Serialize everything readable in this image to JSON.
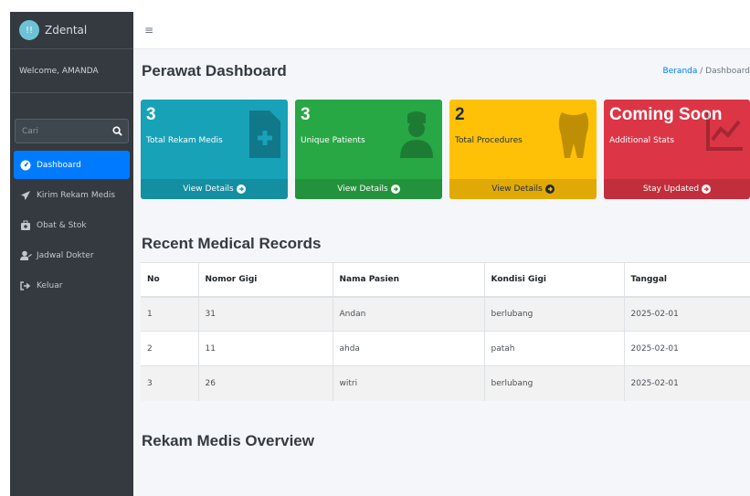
{
  "brand": {
    "name": "Zdental",
    "logo_glyph": "!!"
  },
  "sidebar": {
    "welcome": "Welcome, AMANDA",
    "search_placeholder": "Cari",
    "items": [
      {
        "label": "Dashboard",
        "icon": "tachometer-icon",
        "active": true
      },
      {
        "label": "Kirim Rekam Medis",
        "icon": "paper-plane-icon",
        "active": false
      },
      {
        "label": "Obat & Stok",
        "icon": "medkit-icon",
        "active": false
      },
      {
        "label": "Jadwal Dokter",
        "icon": "user-clock-icon",
        "active": false
      },
      {
        "label": "Keluar",
        "icon": "sign-out-icon",
        "active": false
      }
    ]
  },
  "header": {
    "title": "Perawat Dashboard",
    "breadcrumb_home": "Beranda",
    "breadcrumb_sep": "/",
    "breadcrumb_current": "Dashboard"
  },
  "boxes": [
    {
      "count": "3",
      "label": "Total Rekam Medis",
      "footer": "View Details",
      "color": "#17a2b8",
      "icon": "file-medical-icon"
    },
    {
      "count": "3",
      "label": "Unique Patients",
      "footer": "View Details",
      "color": "#28a745",
      "icon": "user-nurse-icon"
    },
    {
      "count": "2",
      "label": "Total Procedures",
      "footer": "View Details",
      "color": "#ffc107",
      "icon": "tooth-icon"
    },
    {
      "count": "Coming Soon",
      "label": "Additional Stats",
      "footer": "Stay Updated",
      "color": "#dc3545",
      "icon": "chart-line-icon"
    }
  ],
  "records": {
    "title": "Recent Medical Records",
    "columns": [
      "No",
      "Nomor Gigi",
      "Nama Pasien",
      "Kondisi Gigi",
      "Tanggal"
    ],
    "rows": [
      [
        "1",
        "31",
        "Andan",
        "berlubang",
        "2025-02-01"
      ],
      [
        "2",
        "11",
        "ahda",
        "patah",
        "2025-02-01"
      ],
      [
        "3",
        "26",
        "witri",
        "berlubang",
        "2025-02-01"
      ]
    ]
  },
  "overview": {
    "title": "Rekam Medis Overview"
  },
  "colors": {
    "sidebar": "#343a40",
    "primary": "#007bff",
    "content_bg": "#f4f6f9"
  }
}
